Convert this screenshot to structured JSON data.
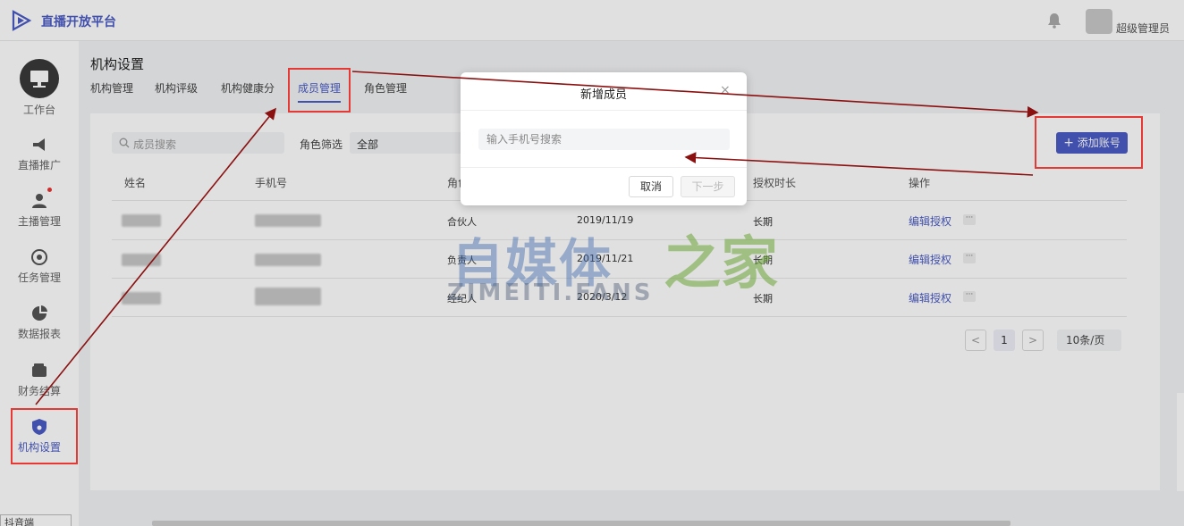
{
  "app": {
    "title": "直播开放平台",
    "admin": "超级管理员"
  },
  "sidebar": {
    "items": [
      {
        "label": "工作台",
        "icon": "monitor-icon"
      },
      {
        "label": "直播推广",
        "icon": "megaphone-icon"
      },
      {
        "label": "主播管理",
        "icon": "anchor-icon"
      },
      {
        "label": "任务管理",
        "icon": "target-icon"
      },
      {
        "label": "数据报表",
        "icon": "pie-chart-icon"
      },
      {
        "label": "财务结算",
        "icon": "wallet-icon"
      },
      {
        "label": "机构设置",
        "icon": "shield-icon"
      }
    ]
  },
  "page": {
    "title": "机构设置",
    "tabs": [
      "机构管理",
      "机构评级",
      "机构健康分",
      "成员管理",
      "角色管理"
    ],
    "active_tab": "成员管理"
  },
  "filters": {
    "search_placeholder": "成员搜索",
    "role_label": "角色筛选",
    "role_value": "全部"
  },
  "toolbar": {
    "add_label": "添加账号"
  },
  "table": {
    "headers": [
      "姓名",
      "手机号",
      "角色",
      "授权时长",
      "操作"
    ],
    "rows": [
      {
        "role": "合伙人",
        "date": "2019/11/19",
        "duration": "长期",
        "action": "编辑授权",
        "more": "···"
      },
      {
        "role": "负责人",
        "date": "2019/11/21",
        "duration": "长期",
        "action": "编辑授权",
        "more": "···"
      },
      {
        "role": "经纪人",
        "date": "2020/3/12",
        "duration": "长期",
        "action": "编辑授权",
        "more": "···"
      }
    ]
  },
  "pagination": {
    "prev": "<",
    "current": "1",
    "next": ">",
    "page_size": "10条/页"
  },
  "modal": {
    "title": "新增成员",
    "close": "×",
    "input_placeholder": "输入手机号搜索",
    "cancel": "取消",
    "next": "下一步"
  },
  "watermark": {
    "cn": "自媒体",
    "cn_accent": "之家",
    "en": "ZIMEITI.FANS"
  },
  "footer": {
    "select": "抖音端"
  },
  "colors": {
    "accent": "#4b5cc4",
    "annotation": "#e53935",
    "arrow": "#8b1010"
  }
}
